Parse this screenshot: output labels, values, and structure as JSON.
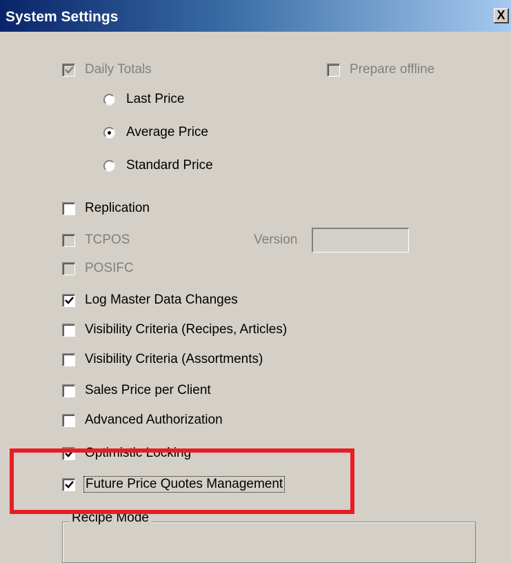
{
  "window": {
    "title": "System Settings",
    "close_label": "X"
  },
  "daily_totals": {
    "label": "Daily Totals",
    "checked": true,
    "disabled": true
  },
  "prepare_offline": {
    "label": "Prepare offline",
    "checked": false,
    "disabled": true
  },
  "price_options": [
    {
      "label": "Last Price",
      "selected": false
    },
    {
      "label": "Average Price",
      "selected": true
    },
    {
      "label": "Standard Price",
      "selected": false
    }
  ],
  "settings": [
    {
      "label": "Replication",
      "checked": false,
      "disabled": false
    },
    {
      "label": "TCPOS",
      "checked": false,
      "disabled": true
    },
    {
      "label": "POSIFC",
      "checked": false,
      "disabled": true
    },
    {
      "label": "Log Master Data Changes",
      "checked": true,
      "disabled": false
    },
    {
      "label": "Visibility Criteria (Recipes, Articles)",
      "checked": false,
      "disabled": false
    },
    {
      "label": "Visibility Criteria (Assortments)",
      "checked": false,
      "disabled": false
    },
    {
      "label": "Sales Price per Client",
      "checked": false,
      "disabled": false
    },
    {
      "label": "Advanced Authorization",
      "checked": false,
      "disabled": false
    },
    {
      "label": "Optimistic Locking",
      "checked": true,
      "disabled": false
    },
    {
      "label": "Future Price Quotes Management",
      "checked": true,
      "disabled": false
    }
  ],
  "version": {
    "label": "Version",
    "value": ""
  },
  "recipe_mode": {
    "label": "Recipe Mode"
  },
  "colors": {
    "highlight": "#e81c24",
    "dialog_bg": "#d4d0c8",
    "title_bar": "#0a246a"
  }
}
